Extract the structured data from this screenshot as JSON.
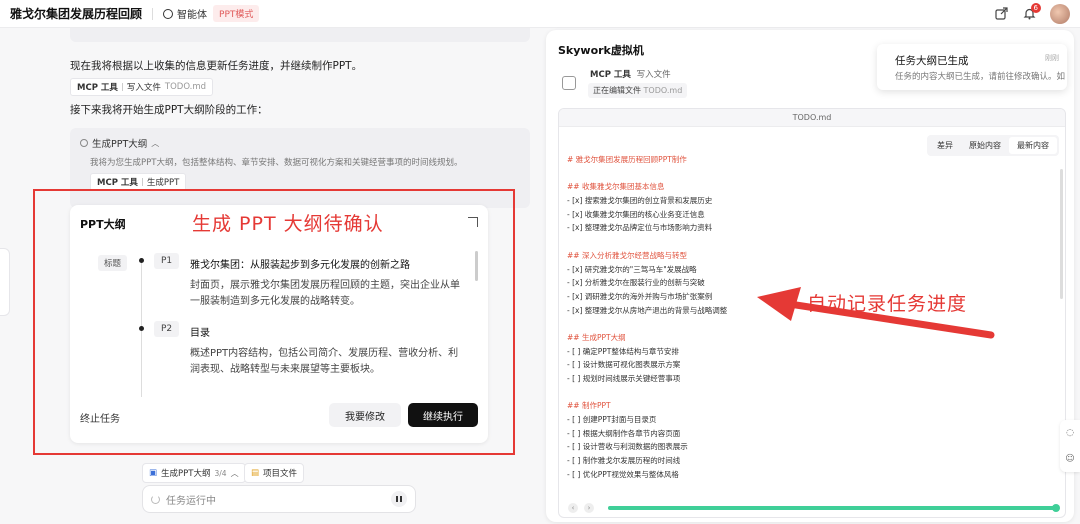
{
  "header": {
    "app_title": "雅戈尔集团发展历程回顾",
    "agent_label": "智能体",
    "mode_label": "PPT模式",
    "notification_count": "6"
  },
  "chat": {
    "message_1": "现在我将根据以上收集的信息更新任务进度，并继续制作PPT。",
    "tool_chip_1": {
      "name": "MCP 工具",
      "action": "写入文件",
      "file": "TODO.md"
    },
    "message_2": "接下来我将开始生成PPT大纲阶段的工作：",
    "step": {
      "title": "生成PPT大纲",
      "desc": "我将为您生成PPT大纲，包括整体结构、章节安排、数据可视化方案和关键经营事项的时间线规划。",
      "chip": {
        "name": "MCP 工具",
        "action": "生成PPT"
      }
    }
  },
  "outline_card": {
    "title": "PPT大纲",
    "annotation": "生成 PPT 大纲待确认",
    "tag_title": "标题",
    "pages": [
      {
        "num": "P1",
        "title": "雅戈尔集团：从服装起步到多元化发展的创新之路",
        "desc": "封面页，展示雅戈尔集团发展历程回顾的主题，突出企业从单一服装制造到多元化发展的战略转变。"
      },
      {
        "num": "P2",
        "title": "目录",
        "desc": "概述PPT内容结构，包括公司简介、发展历程、营收分析、利润表现、战略转型与未来展望等主要板块。"
      }
    ],
    "stop_label": "终止任务",
    "edit_button": "我要修改",
    "continue_button": "继续执行"
  },
  "bottom": {
    "outline_chip": "生成PPT大纲",
    "outline_progress": "3/4",
    "files_chip": "项目文件",
    "input_status": "任务运行中"
  },
  "vm": {
    "title": "Skywork虚拟机",
    "tool_name": "MCP 工具",
    "tool_action": "写入文件",
    "editing_label": "正在编辑文件",
    "editing_file": "TODO.md",
    "file_name": "TODO.md",
    "tabs": [
      "差异",
      "原始内容",
      "最新内容"
    ],
    "active_tab": "最新内容",
    "annotation": "自动记录任务进度",
    "progress_percent": 100,
    "lines": [
      {
        "kind": "h",
        "text": "# 雅戈尔集团发展历程回顾PPT制作"
      },
      {
        "kind": "blank",
        "text": ""
      },
      {
        "kind": "h",
        "text": "## 收集雅戈尔集团基本信息"
      },
      {
        "kind": "t",
        "text": "- [x] 搜索雅戈尔集团的创立背景和发展历史"
      },
      {
        "kind": "t",
        "text": "- [x] 收集雅戈尔集团的核心业务变迁信息"
      },
      {
        "kind": "t",
        "text": "- [x] 整理雅戈尔品牌定位与市场影响力资料"
      },
      {
        "kind": "blank",
        "text": ""
      },
      {
        "kind": "h",
        "text": "## 深入分析雅戈尔经营战略与转型"
      },
      {
        "kind": "t",
        "text": "- [x] 研究雅戈尔的\"三驾马车\"发展战略"
      },
      {
        "kind": "t",
        "text": "- [x] 分析雅戈尔在服装行业的创新与突破"
      },
      {
        "kind": "t",
        "text": "- [x] 调研雅戈尔的海外并购与市场扩张案例"
      },
      {
        "kind": "t",
        "text": "- [x] 整理雅戈尔从房地产退出的背景与战略调整"
      },
      {
        "kind": "blank",
        "text": ""
      },
      {
        "kind": "h",
        "text": "## 生成PPT大纲"
      },
      {
        "kind": "t",
        "text": "- [ ] 确定PPT整体结构与章节安排"
      },
      {
        "kind": "t",
        "text": "- [ ] 设计数据可视化图表展示方案"
      },
      {
        "kind": "t",
        "text": "- [ ] 规划时间线展示关键经营事项"
      },
      {
        "kind": "blank",
        "text": ""
      },
      {
        "kind": "h",
        "text": "## 制作PPT"
      },
      {
        "kind": "t",
        "text": "- [ ] 创建PPT封面与目录页"
      },
      {
        "kind": "t",
        "text": "- [ ] 根据大纲制作各章节内容页面"
      },
      {
        "kind": "t",
        "text": "- [ ] 设计营收与利润数据的图表展示"
      },
      {
        "kind": "t",
        "text": "- [ ] 制作雅戈尔发展历程的时间线"
      },
      {
        "kind": "t",
        "text": "- [ ] 优化PPT视觉效果与整体风格"
      }
    ]
  },
  "toast": {
    "title": "任务大纲已生成",
    "time": "刚刚",
    "body": "任务的内容大纲已生成，请前往修改确认。如"
  },
  "colors": {
    "annotation_red": "#e53935",
    "heading_red": "#e0533e",
    "progress_green": "#3fcf98",
    "mode_badge": "#e05a5a"
  }
}
